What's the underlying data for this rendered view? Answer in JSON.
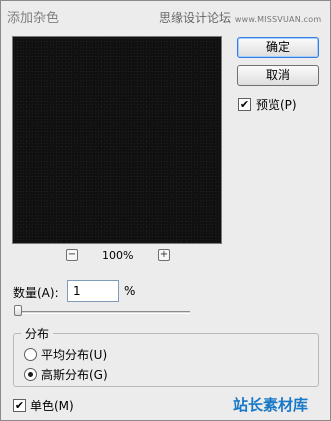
{
  "dialog": {
    "title": "添加杂色",
    "watermark_top": "思缘设计论坛",
    "watermark_site": "www.MISSVUAN.com"
  },
  "preview": {
    "zoom_minus": "−",
    "zoom_value": "100%",
    "zoom_plus": "+"
  },
  "buttons": {
    "ok": "确定",
    "cancel": "取消"
  },
  "preview_toggle": {
    "label": "预览(P)",
    "checked_mark": "✔"
  },
  "amount": {
    "label": "数量(A):",
    "value": "1",
    "unit": "%",
    "slider_value": 1
  },
  "distribution": {
    "legend": "分布",
    "options": [
      {
        "label": "平均分布(U)",
        "selected": false
      },
      {
        "label": "高斯分布(G)",
        "selected": true
      }
    ]
  },
  "monochrome": {
    "label": "单色(M)",
    "checked_mark": "✔"
  },
  "watermark_bottom": "站长素材库"
}
